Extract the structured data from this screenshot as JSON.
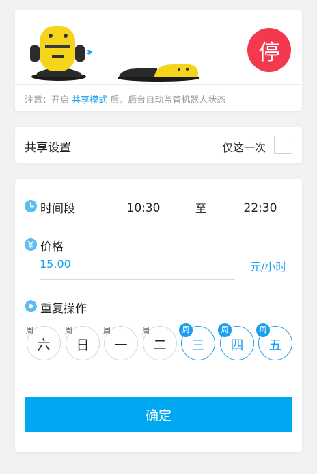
{
  "banner": {
    "stop_label": "停",
    "arrows": "›››",
    "notice_prefix": "注意：开启 ",
    "notice_highlight": "共享模式",
    "notice_suffix": " 后，后台自动监管机器人状态"
  },
  "share": {
    "title": "共享设置",
    "once_label": "仅这一次",
    "once_checked": false
  },
  "time": {
    "label": "时间段",
    "start": "10:30",
    "separator": "至",
    "end": "22:30"
  },
  "price": {
    "label": "价格",
    "value": "15.00",
    "unit": "元/小时"
  },
  "repeat": {
    "label": "重复操作",
    "prefix": "周",
    "days": [
      {
        "name": "六",
        "selected": false
      },
      {
        "name": "日",
        "selected": false
      },
      {
        "name": "一",
        "selected": false
      },
      {
        "name": "二",
        "selected": false
      },
      {
        "name": "三",
        "selected": true
      },
      {
        "name": "四",
        "selected": true
      },
      {
        "name": "五",
        "selected": true
      }
    ]
  },
  "confirm_label": "确定",
  "colors": {
    "accent": "#1a9ef0",
    "button": "#00a7f1",
    "stop": "#f2394d",
    "robot": "#f5d41c"
  }
}
